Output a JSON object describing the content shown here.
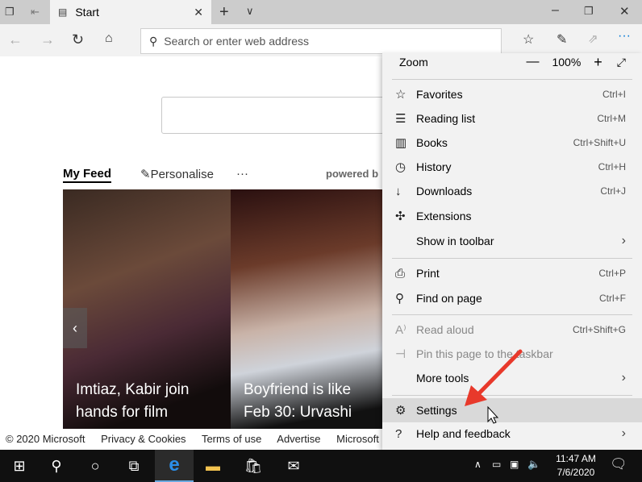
{
  "browser": {
    "tab_title": "Start",
    "address_placeholder": "Search or enter web address"
  },
  "feed": {
    "tabs": [
      "My Feed",
      "Personalise",
      "···"
    ],
    "powered_by": "powered b",
    "cards": [
      {
        "headline_1": "Imtiaz, Kabir join",
        "headline_2": "hands for film"
      },
      {
        "headline_1": "Boyfriend is like",
        "headline_2": "Feb 30: Urvashi"
      }
    ]
  },
  "footer": {
    "links": [
      "© 2020 Microsoft",
      "Privacy & Cookies",
      "Terms of use",
      "Advertise",
      "Microsoft ma"
    ]
  },
  "menu": {
    "zoom_label": "Zoom",
    "zoom_value": "100%",
    "items": [
      {
        "label": "Favorites",
        "shortcut": "Ctrl+I",
        "icon": "favorites-icon"
      },
      {
        "label": "Reading list",
        "shortcut": "Ctrl+M",
        "icon": "reading-list-icon"
      },
      {
        "label": "Books",
        "shortcut": "Ctrl+Shift+U",
        "icon": "books-icon"
      },
      {
        "label": "History",
        "shortcut": "Ctrl+H",
        "icon": "history-icon"
      },
      {
        "label": "Downloads",
        "shortcut": "Ctrl+J",
        "icon": "download-icon"
      },
      {
        "label": "Extensions",
        "shortcut": "",
        "icon": "extensions-icon"
      },
      {
        "label": "Show in toolbar",
        "shortcut": "",
        "icon": ""
      },
      {
        "label": "Print",
        "shortcut": "Ctrl+P",
        "icon": "print-icon"
      },
      {
        "label": "Find on page",
        "shortcut": "Ctrl+F",
        "icon": "search-icon"
      },
      {
        "label": "Read aloud",
        "shortcut": "Ctrl+Shift+G",
        "icon": "read-aloud-icon"
      },
      {
        "label": "Pin this page to the taskbar",
        "shortcut": "",
        "icon": "pin-icon"
      },
      {
        "label": "More tools",
        "shortcut": "",
        "icon": ""
      },
      {
        "label": "Settings",
        "shortcut": "",
        "icon": "gear-icon"
      },
      {
        "label": "Help and feedback",
        "shortcut": "",
        "icon": "help-icon"
      }
    ]
  },
  "taskbar": {
    "time": "11:47 AM",
    "date": "7/6/2020"
  },
  "colors": {
    "accent": "#0078d7",
    "arrow": "#e8392b"
  }
}
